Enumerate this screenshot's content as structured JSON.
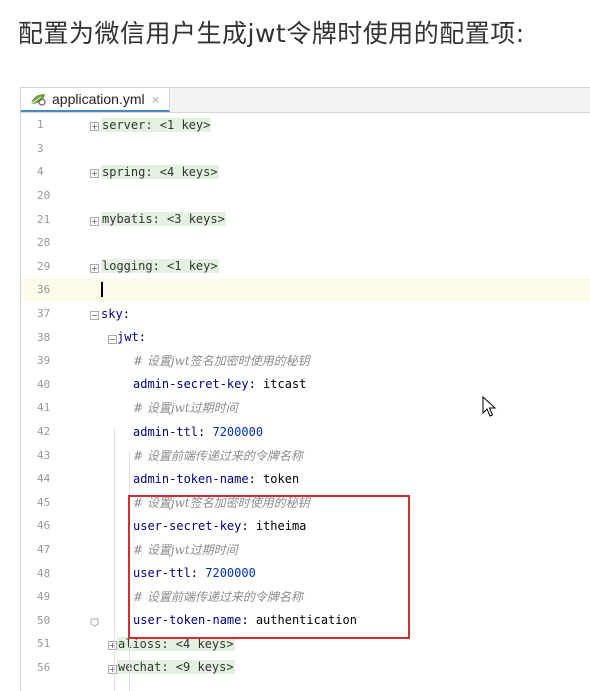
{
  "heading": "配置为微信用户生成jwt令牌时使用的配置项:",
  "tab": {
    "filename": "application.yml",
    "close": "×",
    "icon": "yml-leaf-icon"
  },
  "lines": [
    {
      "num": "1",
      "indent": 0,
      "parts": [
        {
          "t": "server: <1 key>",
          "c": "collapsed"
        }
      ],
      "fold": "plus"
    },
    {
      "num": "3",
      "indent": 0,
      "parts": []
    },
    {
      "num": "4",
      "indent": 0,
      "parts": [
        {
          "t": "spring: <4 keys>",
          "c": "collapsed"
        }
      ],
      "fold": "plus"
    },
    {
      "num": "20",
      "indent": 0,
      "parts": []
    },
    {
      "num": "21",
      "indent": 0,
      "parts": [
        {
          "t": "mybatis: <3 keys>",
          "c": "collapsed"
        }
      ],
      "fold": "plus"
    },
    {
      "num": "28",
      "indent": 0,
      "parts": []
    },
    {
      "num": "29",
      "indent": 0,
      "parts": [
        {
          "t": "logging: <1 key>",
          "c": "collapsed"
        }
      ],
      "fold": "plus"
    },
    {
      "num": "36",
      "indent": 0,
      "parts": [],
      "current": true,
      "cursor": true
    },
    {
      "num": "37",
      "indent": 0,
      "parts": [
        {
          "t": "sky",
          "c": "key"
        },
        {
          "t": ":",
          "c": "val"
        }
      ],
      "fold": "minus"
    },
    {
      "num": "38",
      "indent": 1,
      "parts": [
        {
          "t": "jwt",
          "c": "key"
        },
        {
          "t": ":",
          "c": "val"
        }
      ],
      "fold": "minus"
    },
    {
      "num": "39",
      "indent": 2,
      "parts": [
        {
          "t": "# 设置jwt签名加密时使用的秘钥",
          "c": "cmt"
        }
      ]
    },
    {
      "num": "40",
      "indent": 2,
      "parts": [
        {
          "t": "admin-secret-key",
          "c": "key"
        },
        {
          "t": ": itcast",
          "c": "val"
        }
      ]
    },
    {
      "num": "41",
      "indent": 2,
      "parts": [
        {
          "t": "# 设置jwt过期时间",
          "c": "cmt"
        }
      ]
    },
    {
      "num": "42",
      "indent": 2,
      "parts": [
        {
          "t": "admin-ttl",
          "c": "key"
        },
        {
          "t": ": ",
          "c": "val"
        },
        {
          "t": "7200000",
          "c": "blue"
        }
      ]
    },
    {
      "num": "43",
      "indent": 2,
      "parts": [
        {
          "t": "# 设置前端传递过来的令牌名称",
          "c": "cmt"
        }
      ]
    },
    {
      "num": "44",
      "indent": 2,
      "parts": [
        {
          "t": "admin-token-name",
          "c": "key"
        },
        {
          "t": ": token",
          "c": "val"
        }
      ]
    },
    {
      "num": "45",
      "indent": 2,
      "parts": [
        {
          "t": "# 设置jwt签名加密时使用的秘钥",
          "c": "cmt"
        }
      ]
    },
    {
      "num": "46",
      "indent": 2,
      "parts": [
        {
          "t": "user-secret-key",
          "c": "key"
        },
        {
          "t": ": itheima",
          "c": "val"
        }
      ]
    },
    {
      "num": "47",
      "indent": 2,
      "parts": [
        {
          "t": "# 设置jwt过期时间",
          "c": "cmt"
        }
      ]
    },
    {
      "num": "48",
      "indent": 2,
      "parts": [
        {
          "t": "user-ttl",
          "c": "key"
        },
        {
          "t": ": ",
          "c": "val"
        },
        {
          "t": "7200000",
          "c": "blue"
        }
      ]
    },
    {
      "num": "49",
      "indent": 2,
      "parts": [
        {
          "t": "# 设置前端传递过来的令牌名称",
          "c": "cmt"
        }
      ]
    },
    {
      "num": "50",
      "indent": 2,
      "parts": [
        {
          "t": "user-token-name",
          "c": "key"
        },
        {
          "t": ": authentication",
          "c": "val"
        }
      ],
      "fold": "end"
    },
    {
      "num": "51",
      "indent": 1,
      "parts": [
        {
          "t": "alioss: <4 keys>",
          "c": "collapsed"
        }
      ],
      "fold": "plus"
    },
    {
      "num": "56",
      "indent": 1,
      "parts": [
        {
          "t": "wechat: <9 keys>",
          "c": "collapsed"
        }
      ],
      "fold": "plus"
    }
  ],
  "colors": {
    "highlight_box": "#d32f2f",
    "current_line": "#fdfbe9",
    "key": "#000080",
    "number": "#0033b3",
    "comment": "#8c8c8c"
  }
}
